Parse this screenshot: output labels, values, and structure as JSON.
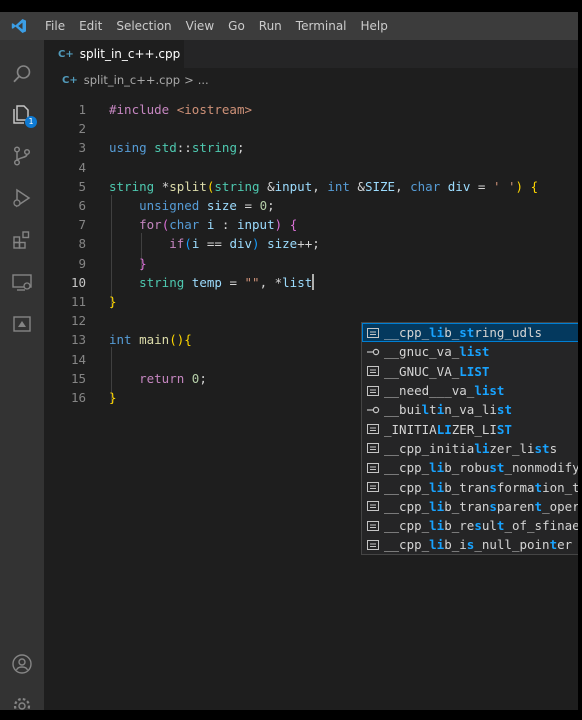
{
  "menubar": {
    "items": [
      "File",
      "Edit",
      "Selection",
      "View",
      "Go",
      "Run",
      "Terminal",
      "Help"
    ]
  },
  "activity": {
    "explorer_badge": "1",
    "icons": [
      "search-icon",
      "explorer-icon",
      "source-control-icon",
      "run-debug-icon",
      "extensions-icon",
      "remote-explorer-icon",
      "testing-icon",
      "account-icon",
      "settings-gear-icon"
    ]
  },
  "tab": {
    "icon_glyph": "C+",
    "label": "split_in_c++.cpp"
  },
  "breadcrumb": {
    "icon_glyph": "C+",
    "file": "split_in_c++.cpp",
    "sep": ">",
    "more": "..."
  },
  "editor": {
    "line_numbers": [
      "1",
      "2",
      "3",
      "4",
      "5",
      "6",
      "7",
      "8",
      "9",
      "10",
      "11",
      "12",
      "13",
      "14",
      "15",
      "16"
    ],
    "active_line": "10",
    "lines": [
      "#include <iostream>",
      "",
      "using std::string;",
      "",
      "string *split(string &input, int &SIZE, char div = ' ') {",
      "    unsigned size = 0;",
      "    for(char i : input) {",
      "        if(i == div) size++;",
      "    }",
      "    string temp = \"\", *list",
      "}",
      "",
      "int main(){",
      "",
      "    return 0;",
      "}"
    ]
  },
  "suggest": {
    "items": [
      {
        "label": "__cpp_lib_string_udls",
        "kind": "constant",
        "selected": true
      },
      {
        "label": "__gnuc_va_list",
        "kind": "typedef"
      },
      {
        "label": "__GNUC_VA_LIST",
        "kind": "constant"
      },
      {
        "label": "__need___va_list",
        "kind": "constant"
      },
      {
        "label": "__builtin_va_list",
        "kind": "typedef"
      },
      {
        "label": "_INITIALIZER_LIST",
        "kind": "constant"
      },
      {
        "label": "__cpp_initializer_lists",
        "kind": "constant"
      },
      {
        "label": "__cpp_lib_robust_nonmodifying_s",
        "kind": "constant"
      },
      {
        "label": "__cpp_lib_transformation_trait_",
        "kind": "constant"
      },
      {
        "label": "__cpp_lib_transparent_operators",
        "kind": "constant"
      },
      {
        "label": "__cpp_lib_result_of_sfinae",
        "kind": "constant"
      },
      {
        "label": "__cpp_lib_is_null_pointer",
        "kind": "constant"
      }
    ]
  },
  "colors": {
    "accent": "#007fd4",
    "match_highlight": "#18a3ff",
    "editor_bg": "#1e1e1e"
  }
}
